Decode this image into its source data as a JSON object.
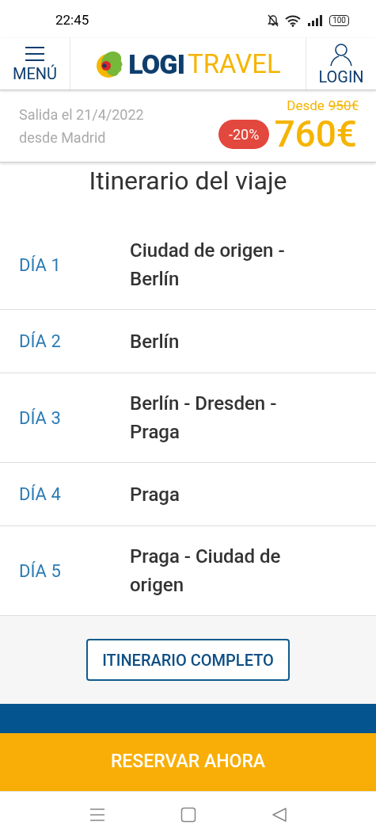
{
  "status_bar": {
    "time": "22:45",
    "battery": "100"
  },
  "header": {
    "menu_label": "MENÚ",
    "logo_part_1": "LOGI",
    "logo_part_2": "TRAVEL",
    "login_label": "LOGIN"
  },
  "trip": {
    "departure_line_1": "Salida el 21/4/2022",
    "departure_line_2": "desde Madrid",
    "from_label": "Desde",
    "old_price": "950€",
    "discount": "-20%",
    "price": "760€"
  },
  "itinerary": {
    "title": "Itinerario del viaje",
    "days": [
      {
        "day": "DÍA 1",
        "route": "Ciudad de origen - Berlín"
      },
      {
        "day": "DÍA 2",
        "route": "Berlín"
      },
      {
        "day": "DÍA 3",
        "route": "Berlín - Dresden - Praga"
      },
      {
        "day": "DÍA 4",
        "route": "Praga"
      },
      {
        "day": "DÍA 5",
        "route": "Praga - Ciudad de origen"
      }
    ],
    "full_button": "ITINERARIO COMPLETO"
  },
  "book_button": "RESERVAR AHORA"
}
